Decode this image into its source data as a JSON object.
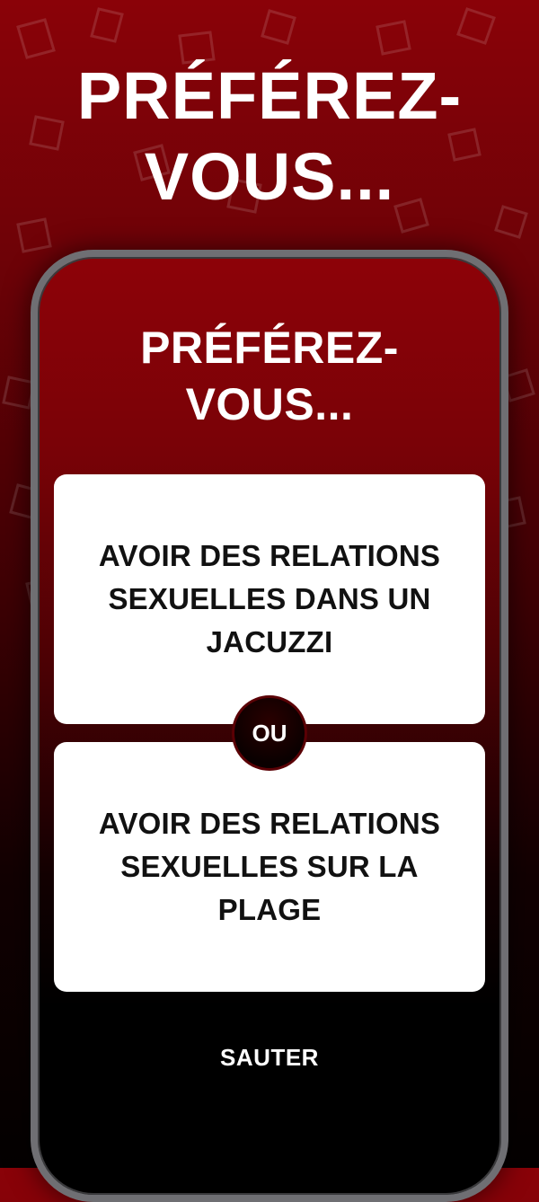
{
  "promo": {
    "title_line1": "PRÉFÉREZ-",
    "title_line2": "VOUS..."
  },
  "screen": {
    "title_line1": "PRÉFÉREZ-",
    "title_line2": "VOUS...",
    "option_a": "AVOIR DES RELATIONS SEXUELLES DANS UN JACUZZI",
    "separator": "OU",
    "option_b": "AVOIR DES RELATIONS SEXUELLES SUR LA PLAGE",
    "skip_label": "SAUTER"
  },
  "colors": {
    "background_top": "#8a0208",
    "background_bottom": "#040001",
    "card": "#ffffff",
    "card_text": "#111111",
    "frame": "#6f6f73"
  },
  "icons": {
    "background_pattern": "scattered-cup-icons"
  }
}
